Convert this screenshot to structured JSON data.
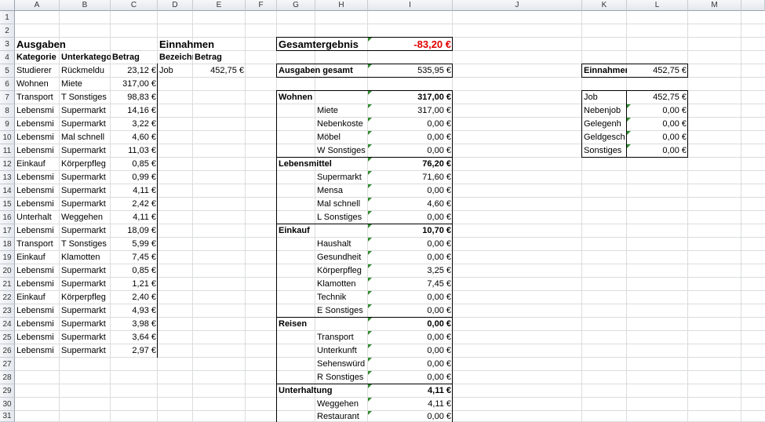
{
  "columns": [
    "A",
    "B",
    "C",
    "D",
    "E",
    "F",
    "G",
    "H",
    "I",
    "J",
    "K",
    "L",
    "M"
  ],
  "rows": [
    "1",
    "2",
    "3",
    "4",
    "5",
    "6",
    "7",
    "8",
    "9",
    "10",
    "11",
    "12",
    "13",
    "14",
    "15",
    "16",
    "17",
    "18",
    "19",
    "20",
    "21",
    "22",
    "23",
    "24",
    "25",
    "26",
    "27",
    "28",
    "29",
    "30",
    "31"
  ],
  "ausgaben": {
    "title": "Ausgaben",
    "headers": [
      "Kategorie",
      "Unterkatego",
      "Betrag"
    ],
    "rows": [
      [
        "Studierer",
        "Rückmeldu",
        "23,12 €"
      ],
      [
        "Wohnen",
        "Miete",
        "317,00 €"
      ],
      [
        "Transport",
        "T Sonstiges",
        "98,83 €"
      ],
      [
        "Lebensmi",
        "Supermarkt",
        "14,16 €"
      ],
      [
        "Lebensmi",
        "Supermarkt",
        "3,22 €"
      ],
      [
        "Lebensmi",
        "Mal schnell",
        "4,60 €"
      ],
      [
        "Lebensmi",
        "Supermarkt",
        "11,03 €"
      ],
      [
        "Einkauf",
        "Körperpfleg",
        "0,85 €"
      ],
      [
        "Lebensmi",
        "Supermarkt",
        "0,99 €"
      ],
      [
        "Lebensmi",
        "Supermarkt",
        "4,11 €"
      ],
      [
        "Lebensmi",
        "Supermarkt",
        "2,42 €"
      ],
      [
        "Unterhalt",
        "Weggehen",
        "4,11 €"
      ],
      [
        "Lebensmi",
        "Supermarkt",
        "18,09 €"
      ],
      [
        "Transport",
        "T Sonstiges",
        "5,99 €"
      ],
      [
        "Einkauf",
        "Klamotten",
        "7,45 €"
      ],
      [
        "Lebensmi",
        "Supermarkt",
        "0,85 €"
      ],
      [
        "Lebensmi",
        "Supermarkt",
        "1,21 €"
      ],
      [
        "Einkauf",
        "Körperpfleg",
        "2,40 €"
      ],
      [
        "Lebensmi",
        "Supermarkt",
        "4,93 €"
      ],
      [
        "Lebensmi",
        "Supermarkt",
        "3,98 €"
      ],
      [
        "Lebensmi",
        "Supermarkt",
        "3,64 €"
      ],
      [
        "Lebensmi",
        "Supermarkt",
        "2,97 €"
      ]
    ]
  },
  "einnahmen": {
    "title": "Einnahmen",
    "headers": [
      "Bezeichn",
      "Betrag"
    ],
    "rows": [
      [
        "Job",
        "452,75 €"
      ]
    ]
  },
  "summary": {
    "gesamtergebnis_label": "Gesamtergebnis",
    "gesamtergebnis_value": "-83,20 €",
    "ausgaben_gesamt_label": "Ausgaben gesamt",
    "ausgaben_gesamt_value": "535,95 €",
    "breakdown": [
      {
        "row": 7,
        "cat": "Wohnen",
        "val": "317,00 €",
        "bold": true
      },
      {
        "row": 8,
        "sub": "Miete",
        "val": "317,00 €"
      },
      {
        "row": 9,
        "sub": "Nebenkoste",
        "val": "0,00 €"
      },
      {
        "row": 10,
        "sub": "Möbel",
        "val": "0,00 €"
      },
      {
        "row": 11,
        "sub": "W Sonstiges",
        "val": "0,00 €"
      },
      {
        "row": 12,
        "cat": "Lebensmittel",
        "val": "76,20 €",
        "bold": true
      },
      {
        "row": 13,
        "sub": "Supermarkt",
        "val": "71,60 €"
      },
      {
        "row": 14,
        "sub": "Mensa",
        "val": "0,00 €"
      },
      {
        "row": 15,
        "sub": "Mal schnell",
        "val": "4,60 €"
      },
      {
        "row": 16,
        "sub": "L Sonstiges",
        "val": "0,00 €"
      },
      {
        "row": 17,
        "cat": "Einkauf",
        "val": "10,70 €",
        "bold": true
      },
      {
        "row": 18,
        "sub": "Haushalt",
        "val": "0,00 €"
      },
      {
        "row": 19,
        "sub": "Gesundheit",
        "val": "0,00 €"
      },
      {
        "row": 20,
        "sub": "Körperpfleg",
        "val": "3,25 €"
      },
      {
        "row": 21,
        "sub": "Klamotten",
        "val": "7,45 €"
      },
      {
        "row": 22,
        "sub": "Technik",
        "val": "0,00 €"
      },
      {
        "row": 23,
        "sub": "E Sonstiges",
        "val": "0,00 €"
      },
      {
        "row": 24,
        "cat": "Reisen",
        "val": "0,00 €",
        "bold": true
      },
      {
        "row": 25,
        "sub": "Transport",
        "val": "0,00 €"
      },
      {
        "row": 26,
        "sub": "Unterkunft",
        "val": "0,00 €"
      },
      {
        "row": 27,
        "sub": "Sehenswürd",
        "val": "0,00 €"
      },
      {
        "row": 28,
        "sub": "R Sonstiges",
        "val": "0,00 €"
      },
      {
        "row": 29,
        "cat": "Unterhaltung",
        "val": "4,11 €",
        "bold": true
      },
      {
        "row": 30,
        "sub": "Weggehen",
        "val": "4,11 €"
      },
      {
        "row": 31,
        "sub": "Restaurant",
        "val": "0,00 €"
      }
    ]
  },
  "income_summary": {
    "einnahmen_label": "Einnahmen",
    "einnahmen_value": "452,75 €",
    "items": [
      [
        "Job",
        "452,75 €"
      ],
      [
        "Nebenjob",
        "0,00 €"
      ],
      [
        "Gelegenh",
        "0,00 €"
      ],
      [
        "Geldgesch",
        "0,00 €"
      ],
      [
        "Sonstiges",
        "0,00 €"
      ]
    ]
  },
  "colors": {
    "negative": "#e00000",
    "comment_marker": "#2e8b2e",
    "header_bg": "#e4e8ee",
    "gridline": "#dadcdd"
  }
}
